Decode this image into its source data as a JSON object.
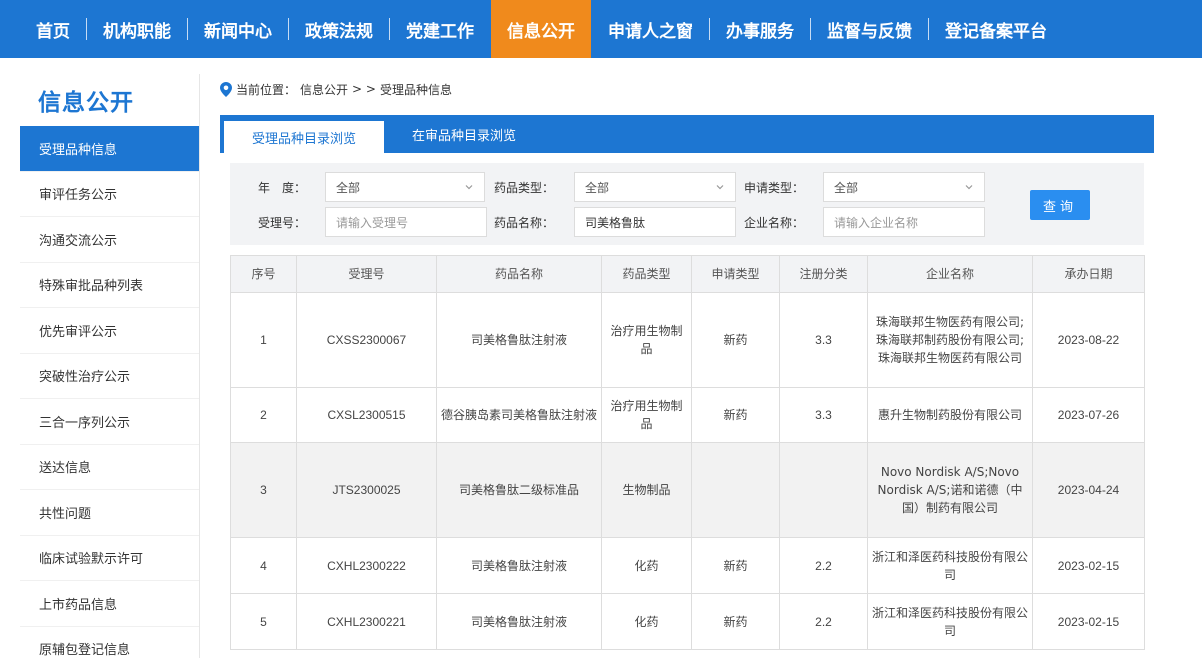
{
  "nav": {
    "items": [
      "首页",
      "机构职能",
      "新闻中心",
      "政策法规",
      "党建工作",
      "信息公开",
      "申请人之窗",
      "办事服务",
      "监督与反馈",
      "登记备案平台"
    ],
    "active": "信息公开"
  },
  "sidebar": {
    "title": "信息公开",
    "items": [
      "受理品种信息",
      "审评任务公示",
      "沟通交流公示",
      "特殊审批品种列表",
      "优先审评公示",
      "突破性治疗公示",
      "三合一序列公示",
      "送达信息",
      "共性问题",
      "临床试验默示许可",
      "上市药品信息",
      "原辅包登记信息"
    ],
    "active_index": 0
  },
  "breadcrumb": {
    "prefix": "当前位置：",
    "section": "信息公开",
    "arrows": "> >",
    "current": "受理品种信息"
  },
  "tabs": [
    "受理品种目录浏览",
    "在审品种目录浏览"
  ],
  "filter": {
    "year_label": "年　度：",
    "year_value": "全部",
    "drug_type_label": "药品类型：",
    "drug_type_value": "全部",
    "apply_type_label": "申请类型：",
    "apply_type_value": "全部",
    "accept_no_label": "受理号：",
    "accept_no_placeholder": "请输入受理号",
    "drug_name_label": "药品名称：",
    "drug_name_value": "司美格鲁肽",
    "company_label": "企业名称：",
    "company_placeholder": "请输入企业名称",
    "query_label": "查询"
  },
  "table": {
    "headers": [
      "序号",
      "受理号",
      "药品名称",
      "药品类型",
      "申请类型",
      "注册分类",
      "企业名称",
      "承办日期"
    ],
    "rows": [
      {
        "no": "1",
        "accept_no": "CXSS2300067",
        "drug_name": "司美格鲁肽注射液",
        "drug_type": "治疗用生物制品",
        "apply_type": "新药",
        "reg_class": "3.3",
        "company": "珠海联邦生物医药有限公司;珠海联邦制药股份有限公司;珠海联邦生物医药有限公司",
        "date": "2023-08-22"
      },
      {
        "no": "2",
        "accept_no": "CXSL2300515",
        "drug_name": "德谷胰岛素司美格鲁肽注射液",
        "drug_type": "治疗用生物制品",
        "apply_type": "新药",
        "reg_class": "3.3",
        "company": "惠升生物制药股份有限公司",
        "date": "2023-07-26"
      },
      {
        "no": "3",
        "accept_no": "JTS2300025",
        "drug_name": "司美格鲁肽二级标准品",
        "drug_type": "生物制品",
        "apply_type": "",
        "reg_class": "",
        "company": "Novo Nordisk A/S;Novo Nordisk A/S;诺和诺德（中国）制药有限公司",
        "date": "2023-04-24"
      },
      {
        "no": "4",
        "accept_no": "CXHL2300222",
        "drug_name": "司美格鲁肽注射液",
        "drug_type": "化药",
        "apply_type": "新药",
        "reg_class": "2.2",
        "company": "浙江和泽医药科技股份有限公司",
        "date": "2023-02-15"
      },
      {
        "no": "5",
        "accept_no": "CXHL2300221",
        "drug_name": "司美格鲁肽注射液",
        "drug_type": "化药",
        "apply_type": "新药",
        "reg_class": "2.2",
        "company": "浙江和泽医药科技股份有限公司",
        "date": "2023-02-15"
      }
    ]
  },
  "colors": {
    "primary": "#1d76d2",
    "accent": "#f08a1c",
    "button": "#2a8ef0"
  }
}
